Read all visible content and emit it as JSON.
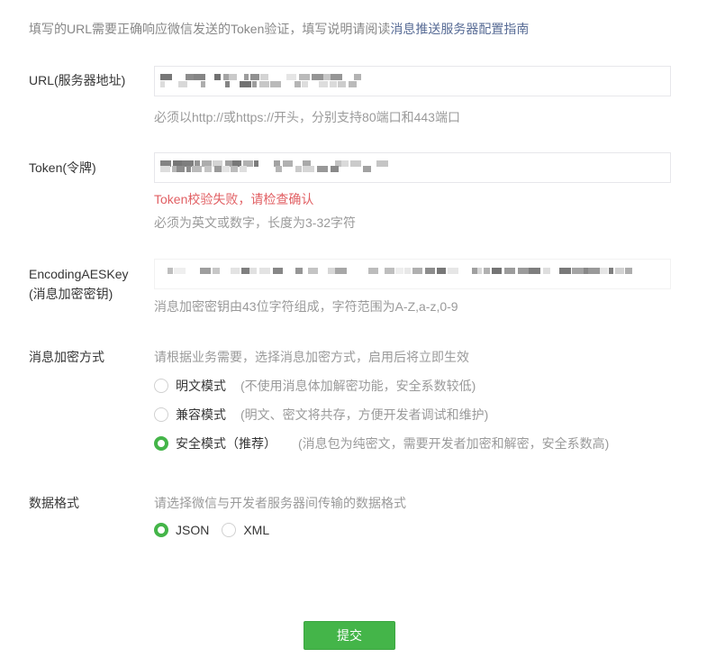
{
  "intro": {
    "text": "填写的URL需要正确响应微信发送的Token验证，填写说明请阅读",
    "link": "消息推送服务器配置指南"
  },
  "url": {
    "label": "URL(服务器地址)",
    "tip": "必须以http://或https://开头，分别支持80端口和443端口"
  },
  "token": {
    "label": "Token(令牌)",
    "error": "Token校验失败，请检查确认",
    "tip": "必须为英文或数字，长度为3-32字符"
  },
  "aes": {
    "label_line1": "EncodingAESKey",
    "label_line2": "(消息加密密钥)",
    "tip": "消息加密密钥由43位字符组成，字符范围为A-Z,a-z,0-9"
  },
  "encryption": {
    "label": "消息加密方式",
    "tip": "请根据业务需要，选择消息加密方式，启用后将立即生效",
    "options": [
      {
        "label": "明文模式",
        "desc": "(不使用消息体加解密功能，安全系数较低)",
        "checked": false
      },
      {
        "label": "兼容模式",
        "desc": "(明文、密文将共存，方便开发者调试和维护)",
        "checked": false
      },
      {
        "label": "安全模式（推荐）",
        "desc": "(消息包为纯密文，需要开发者加密和解密，安全系数高)",
        "checked": true
      }
    ]
  },
  "format": {
    "label": "数据格式",
    "tip": "请选择微信与开发者服务器间传输的数据格式",
    "options": [
      {
        "label": "JSON",
        "checked": true
      },
      {
        "label": "XML",
        "checked": false
      }
    ]
  },
  "submit_label": "提交",
  "colors": {
    "accent": "#44b549",
    "link": "#576b95",
    "error": "#e15f63"
  }
}
